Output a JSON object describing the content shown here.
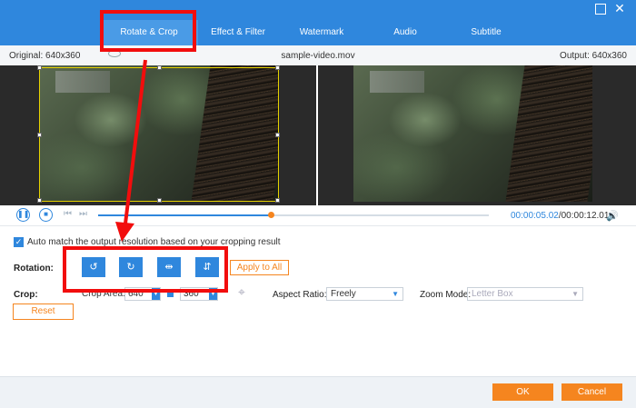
{
  "tabs": [
    {
      "label": "Rotate & Crop"
    },
    {
      "label": "Effect & Filter"
    },
    {
      "label": "Watermark"
    },
    {
      "label": "Audio"
    },
    {
      "label": "Subtitle"
    }
  ],
  "info": {
    "original": "Original: 640x360",
    "filename": "sample-video.mov",
    "output": "Output: 640x360"
  },
  "playback": {
    "current_time": "00:00:05.02",
    "total_time": "/00:00:12.01",
    "progress_fraction": 0.44
  },
  "settings": {
    "auto_match_label": "Auto match the output resolution based on your cropping result",
    "auto_match_checked": true,
    "rotation_label": "Rotation:",
    "rotation_buttons": [
      {
        "icon": "rotate-left-icon",
        "glyph": "↺"
      },
      {
        "icon": "rotate-right-icon",
        "glyph": "↻"
      },
      {
        "icon": "flip-horizontal-icon",
        "glyph": "⇹"
      },
      {
        "icon": "flip-vertical-icon",
        "glyph": "⇵"
      }
    ],
    "apply_all_label": "Apply to All",
    "crop_label": "Crop:",
    "crop_area_label": "Crop Area:",
    "crop_width": "640",
    "crop_height": "360",
    "aspect_ratio_label": "Aspect Ratio:",
    "aspect_ratio_value": "Freely",
    "zoom_mode_label": "Zoom Mode:",
    "zoom_mode_value": "Letter Box",
    "reset_label": "Reset"
  },
  "footer": {
    "ok_label": "OK",
    "cancel_label": "Cancel"
  },
  "colors": {
    "accent": "#2f87dd",
    "orange": "#f5851f",
    "annotation_red": "#f20d0d"
  }
}
